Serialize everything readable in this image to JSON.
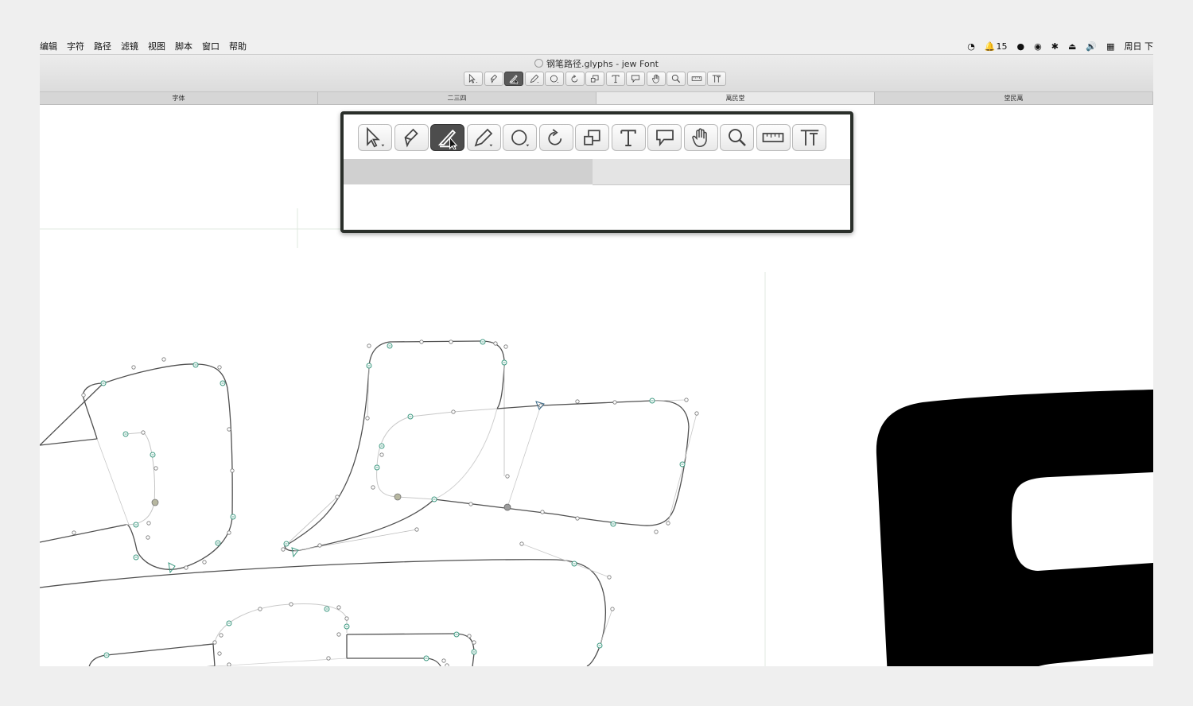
{
  "menubar": {
    "menus": [
      "编辑",
      "字符",
      "路径",
      "滤镜",
      "视图",
      "脚本",
      "窗口",
      "帮助"
    ],
    "notification_count": "15",
    "datetime": "周日 下"
  },
  "window": {
    "title": "钢笔路径.glyphs - jew Font"
  },
  "tabs": [
    "字体",
    "二三四",
    "萬民堂",
    "堂民萬"
  ],
  "active_tab_index": 2,
  "toolbar": {
    "tools": [
      "select-tool",
      "draw-tool",
      "knife-tool",
      "pencil-tool",
      "primitives-tool",
      "rotate-tool",
      "scale-tool",
      "text-tool",
      "annotation-tool",
      "hand-tool",
      "zoom-tool",
      "measurement-tool",
      "metrics-tool"
    ],
    "active_tool": "knife-tool"
  },
  "colors": {
    "path": "#505050",
    "handle": "#a8a8a8",
    "node_green": "#3f9a82",
    "glyph_fill": "#000000"
  }
}
